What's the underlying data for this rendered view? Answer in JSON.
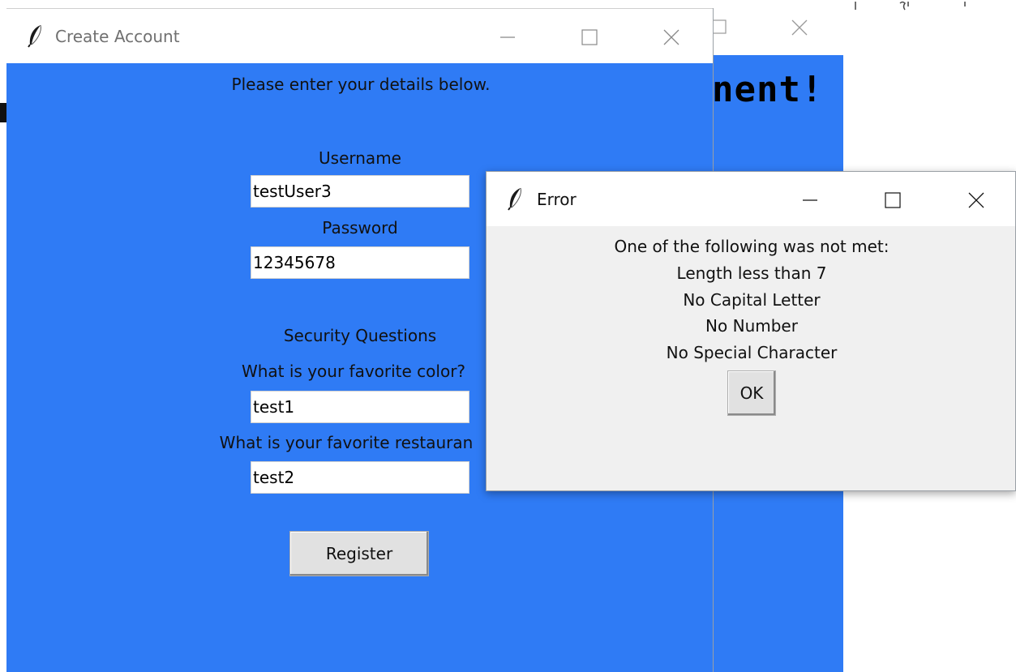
{
  "background_window": {
    "heading": "nent!",
    "body_color": "#2f7bf5"
  },
  "create_account": {
    "title": "Create Account",
    "instructions": "Please enter your details below.",
    "username_label": "Username",
    "username_value": "testUser3",
    "password_label": "Password",
    "password_value": "12345678",
    "security_heading": "Security Questions",
    "question1": "What is your favorite color?",
    "answer1": "test1",
    "question2": "What is your favorite restauran",
    "answer2": "test2",
    "register_label": "Register",
    "body_color": "#2f7bf5"
  },
  "error_dialog": {
    "title": "Error",
    "messages": [
      "One of the following was not met:",
      "Length less than 7",
      "No Capital Letter",
      "No Number",
      "No Special Character"
    ],
    "ok_label": "OK"
  },
  "icons": {
    "app": "feather-icon",
    "minimize": "minimize-icon",
    "maximize": "maximize-icon",
    "close": "close-icon"
  }
}
